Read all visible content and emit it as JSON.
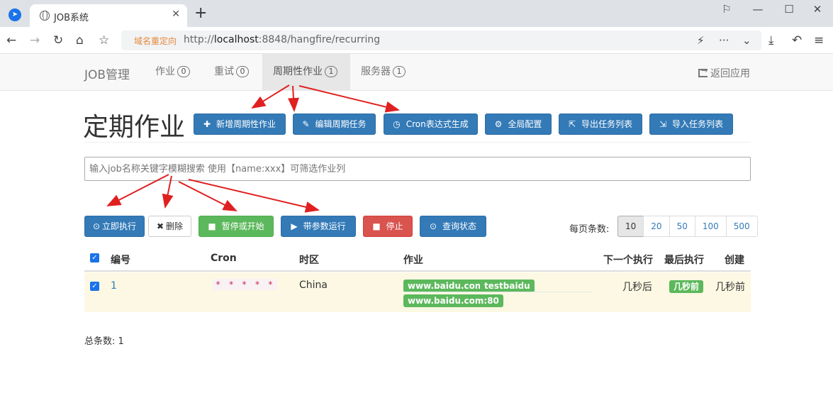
{
  "browser": {
    "tab_title": "JOB系统",
    "url_tag": "域名重定向",
    "url_prefix": "http://",
    "url_host": "localhost",
    "url_rest": ":8848/hangfire/recurring"
  },
  "navbar": {
    "brand": "JOB管理",
    "items": [
      {
        "label": "作业",
        "count": "0"
      },
      {
        "label": "重试",
        "count": "0"
      },
      {
        "label": "周期性作业",
        "count": "1"
      },
      {
        "label": "服务器",
        "count": "1"
      }
    ],
    "back": "返回应用"
  },
  "page": {
    "title": "定期作业",
    "header_buttons": [
      "新增周期性作业",
      "编辑周期任务",
      "Cron表达式生成",
      "全局配置",
      "导出任务列表",
      "导入任务列表"
    ],
    "search_placeholder": "输入job名称关键字模糊搜索 使用【name:xxx】可筛选作业列",
    "action_buttons": [
      "立即执行",
      "删除",
      "暂停或开始",
      "带参数运行",
      "停止",
      "查询状态"
    ],
    "per_page_label": "每页条数:",
    "per_page_options": [
      "10",
      "20",
      "50",
      "100",
      "500"
    ],
    "per_page_selected": "10"
  },
  "table": {
    "headers": [
      "编号",
      "Cron",
      "时区",
      "作业",
      "下一个执行",
      "最后执行",
      "创建"
    ],
    "rows": [
      {
        "id": "1",
        "cron": "* * * * *",
        "timezone": "China",
        "job_tags": [
          "www.baidu.com",
          "testbaidu",
          "www.baidu.com:80"
        ],
        "next": "几秒后",
        "last": "几秒前",
        "created": "几秒前",
        "checked": true
      }
    ]
  },
  "footer": {
    "total": "总条数: 1"
  },
  "colors": {
    "primary": "#337ab7",
    "success": "#5cb85c",
    "danger": "#d9534f",
    "arrow": "#e02020",
    "row_highlight": "#fcf8e3"
  }
}
